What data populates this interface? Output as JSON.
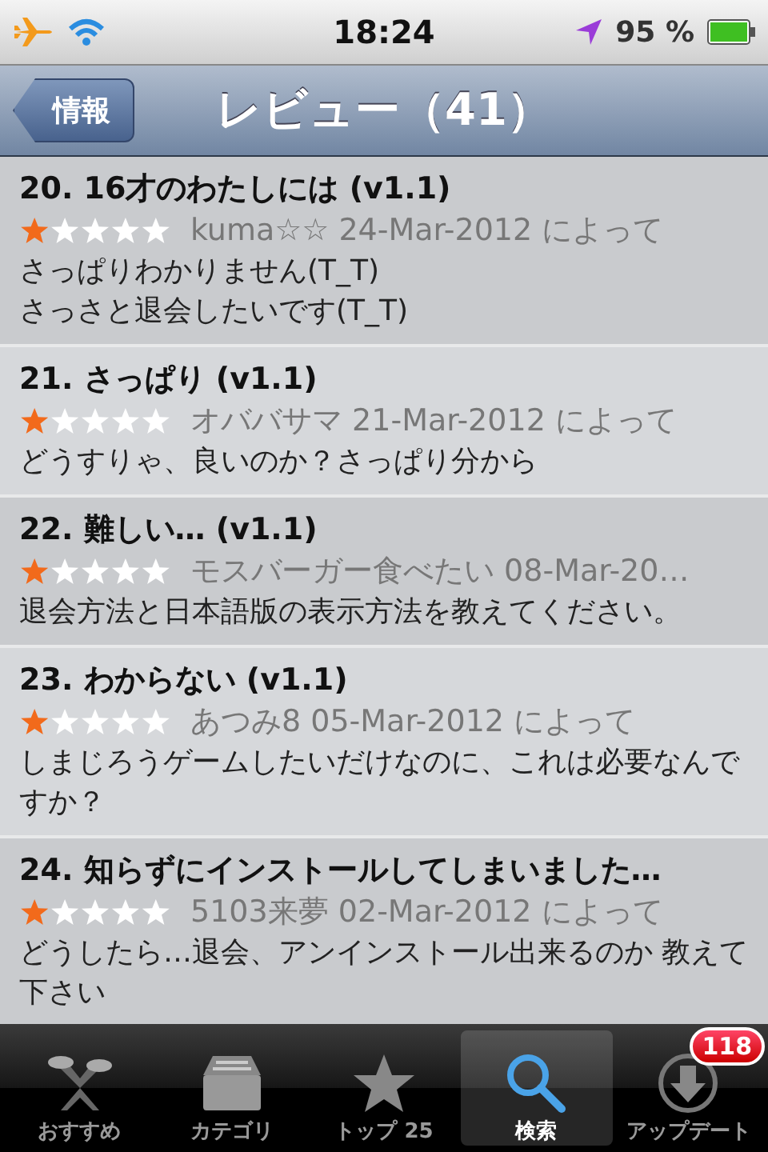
{
  "status_bar": {
    "time": "18:24",
    "battery": "95 %"
  },
  "nav_bar": {
    "back": "情報",
    "title": "レビュー（41）"
  },
  "reviews": [
    {
      "title": "20. 16才のわたしには (v1.1)",
      "stars": 1,
      "meta": "kuma☆☆ 24-Mar-2012 によって",
      "body": "さっぱりわかりません(T_T)\nさっさと退会したいです(T_T)"
    },
    {
      "title": "21. さっぱり (v1.1)",
      "stars": 1,
      "meta": "オババサマ 21-Mar-2012 によって",
      "body": "どうすりゃ、良いのか？さっぱり分から"
    },
    {
      "title": "22. 難しい… (v1.1)",
      "stars": 1,
      "meta": "モスバーガー食べたい 08-Mar-20…",
      "body": "退会方法と日本語版の表示方法を教えてください。"
    },
    {
      "title": "23. わからない (v1.1)",
      "stars": 1,
      "meta": "あつみ8 05-Mar-2012 によって",
      "body": "しまじろうゲームしたいだけなのに、これは必要なんですか？"
    },
    {
      "title": "24. 知らずにインストールしてしまいました…",
      "stars": 1,
      "meta": "5103来夢 02-Mar-2012 によって",
      "body": "どうしたら…退会、アンインストール出来るのか 教えて下さい"
    }
  ],
  "tab_bar": [
    {
      "kind": "featured",
      "label": "おすすめ",
      "selected": false
    },
    {
      "kind": "categories",
      "label": "カテゴリ",
      "selected": false
    },
    {
      "kind": "top",
      "label": "トップ 25",
      "selected": false
    },
    {
      "kind": "search",
      "label": "検索",
      "selected": true
    },
    {
      "kind": "updates",
      "label": "アップデート",
      "selected": false,
      "badge": "118"
    }
  ]
}
